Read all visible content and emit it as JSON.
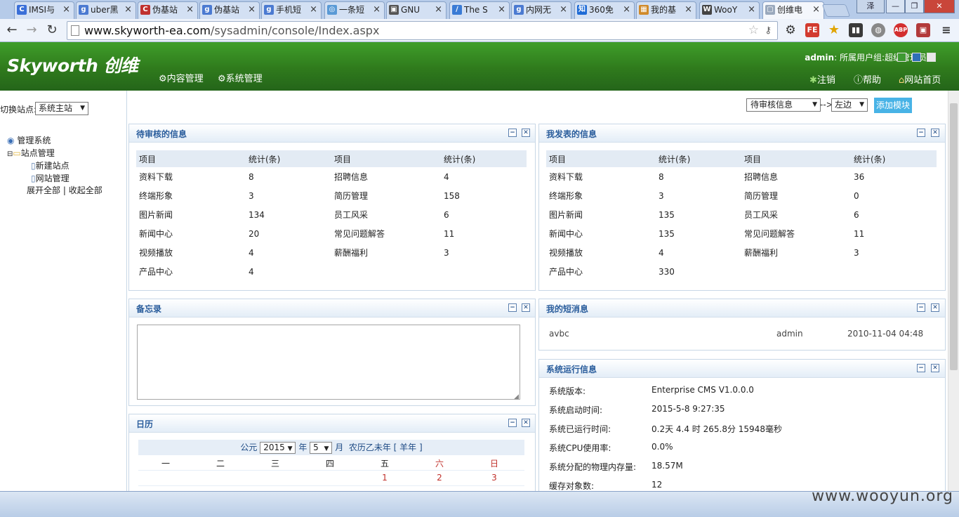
{
  "browser": {
    "tabs": [
      {
        "label": "IMSI与",
        "icon": "C",
        "icon_color": "#3a6fd8"
      },
      {
        "label": "uber黑",
        "icon": "g",
        "icon_color": "#4b7ad1"
      },
      {
        "label": "伪基站",
        "icon": "C",
        "icon_color": "#c0312f"
      },
      {
        "label": "伪基站",
        "icon": "g",
        "icon_color": "#4b7ad1"
      },
      {
        "label": "手机短",
        "icon": "g",
        "icon_color": "#4b7ad1"
      },
      {
        "label": "一条短",
        "icon": "◎",
        "icon_color": "#5a9ad6"
      },
      {
        "label": "GNU",
        "icon": "▣",
        "icon_color": "#555555"
      },
      {
        "label": "The S",
        "icon": "∕",
        "icon_color": "#3a7bd5"
      },
      {
        "label": "内网无",
        "icon": "g",
        "icon_color": "#4b7ad1"
      },
      {
        "label": "360免",
        "icon": "知",
        "icon_color": "#1e6bd6"
      },
      {
        "label": "我的基",
        "icon": "▦",
        "icon_color": "#d08a2a"
      },
      {
        "label": "WooY",
        "icon": "W",
        "icon_color": "#444444"
      },
      {
        "label": "创维电",
        "icon": "▢",
        "icon_color": "#9aa9bd"
      }
    ],
    "url_host": "www.skyworth-ea.com",
    "url_path": "/sysadmin/console/Index.aspx",
    "window_user": "泽",
    "window_buttons": [
      "—",
      "❐",
      "✕"
    ]
  },
  "header": {
    "logo": "Skyworth 创维",
    "menu": [
      "内容管理",
      "系统管理"
    ],
    "user": "admin",
    "user_group": ": 所属用户组:超级管理员",
    "links": [
      "注销",
      "帮助",
      "网站首页"
    ]
  },
  "left": {
    "switch_label": "切换站点:",
    "site_value": "系统主站",
    "tree_root": "管理系统",
    "tree_folder": "站点管理",
    "tree_items": [
      "新建站点",
      "网站管理"
    ],
    "expand_all": "展开全部",
    "collapse_all": "收起全部",
    "sep": "|"
  },
  "controls": {
    "module_select": "待审核信息",
    "arrow": "-->",
    "position_select": "左边",
    "add_button": "添加模块"
  },
  "panels": {
    "pending": {
      "title": "待审核的信息",
      "headers": [
        "项目",
        "统计(条)",
        "项目",
        "统计(条)"
      ],
      "rows": [
        [
          "资料下载",
          "8",
          "招聘信息",
          "4"
        ],
        [
          "终端形象",
          "3",
          "简历管理",
          "158"
        ],
        [
          "图片新闻",
          "134",
          "员工风采",
          "6"
        ],
        [
          "新闻中心",
          "20",
          "常见问题解答",
          "11"
        ],
        [
          "视频播放",
          "4",
          "薪酬福利",
          "3"
        ],
        [
          "产品中心",
          "4",
          "",
          ""
        ]
      ]
    },
    "published": {
      "title": "我发表的信息",
      "headers": [
        "项目",
        "统计(条)",
        "项目",
        "统计(条)"
      ],
      "rows": [
        [
          "资料下载",
          "8",
          "招聘信息",
          "36"
        ],
        [
          "终端形象",
          "3",
          "简历管理",
          "0"
        ],
        [
          "图片新闻",
          "135",
          "员工风采",
          "6"
        ],
        [
          "新闻中心",
          "135",
          "常见问题解答",
          "11"
        ],
        [
          "视频播放",
          "4",
          "薪酬福利",
          "3"
        ],
        [
          "产品中心",
          "330",
          "",
          ""
        ]
      ]
    },
    "memo": {
      "title": "备忘录"
    },
    "messages": {
      "title": "我的短消息",
      "items": [
        {
          "subject": "avbc",
          "from": "admin",
          "time": "2010-11-04 04:48"
        }
      ]
    },
    "calendar": {
      "title": "日历",
      "prefix": "公元",
      "year": "2015",
      "year_unit": "年",
      "month": "5",
      "month_unit": "月",
      "lunar": "农历乙未年 [ 羊年 ]",
      "weekdays": [
        "一",
        "二",
        "三",
        "四",
        "五",
        "六",
        "日"
      ],
      "first_row": [
        "",
        "",
        "",
        "",
        "1",
        "2",
        "3"
      ]
    },
    "sysinfo": {
      "title": "系统运行信息",
      "rows": [
        [
          "系统版本:",
          "Enterprise CMS V1.0.0.0"
        ],
        [
          "系统启动时间:",
          "2015-5-8 9:27:35"
        ],
        [
          "系统已运行时间:",
          "0.2天 4.4 时 265.8分 15948毫秒"
        ],
        [
          "系统CPU使用率:",
          "0.0%"
        ],
        [
          "系统分配的物理内存量:",
          "18.57M"
        ],
        [
          "缓存对象数:",
          "12"
        ]
      ]
    }
  },
  "watermark": "www.wooyun.org"
}
